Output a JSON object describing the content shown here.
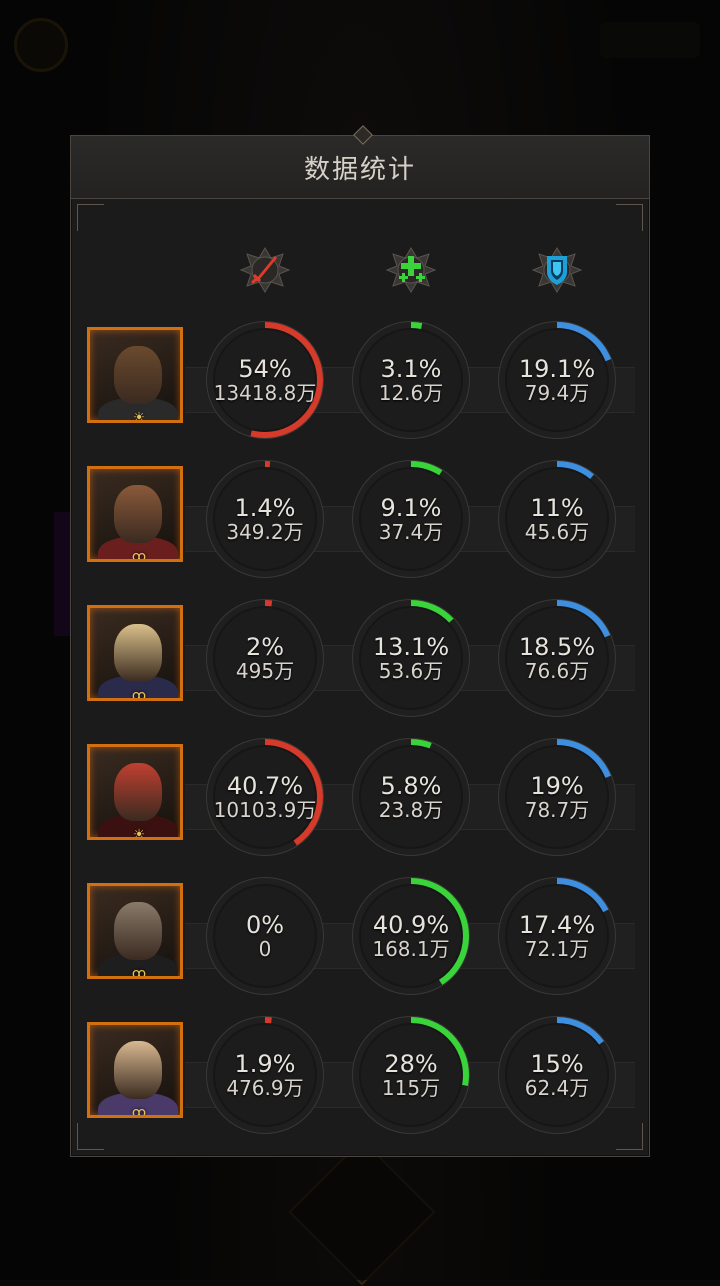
{
  "panel": {
    "title": "数据统计"
  },
  "columns": [
    {
      "icon": "sword-icon",
      "color": "#d63a2a"
    },
    {
      "icon": "heal-plus-icon",
      "color": "#39d33a"
    },
    {
      "icon": "shield-icon",
      "color": "#3f8fe0"
    }
  ],
  "heroes": [
    {
      "badge": "☀",
      "damage": {
        "pct": "54%",
        "val": "13418.8万",
        "frac": 0.54
      },
      "heal": {
        "pct": "3.1%",
        "val": "12.6万",
        "frac": 0.031
      },
      "tank": {
        "pct": "19.1%",
        "val": "79.4万",
        "frac": 0.191
      }
    },
    {
      "badge": "ꝏ",
      "damage": {
        "pct": "1.4%",
        "val": "349.2万",
        "frac": 0.014
      },
      "heal": {
        "pct": "9.1%",
        "val": "37.4万",
        "frac": 0.091
      },
      "tank": {
        "pct": "11%",
        "val": "45.6万",
        "frac": 0.11
      }
    },
    {
      "badge": "ꝏ",
      "damage": {
        "pct": "2%",
        "val": "495万",
        "frac": 0.02
      },
      "heal": {
        "pct": "13.1%",
        "val": "53.6万",
        "frac": 0.131
      },
      "tank": {
        "pct": "18.5%",
        "val": "76.6万",
        "frac": 0.185
      }
    },
    {
      "badge": "☀",
      "damage": {
        "pct": "40.7%",
        "val": "10103.9万",
        "frac": 0.407
      },
      "heal": {
        "pct": "5.8%",
        "val": "23.8万",
        "frac": 0.058
      },
      "tank": {
        "pct": "19%",
        "val": "78.7万",
        "frac": 0.19
      }
    },
    {
      "badge": "ꝏ",
      "damage": {
        "pct": "0%",
        "val": "0",
        "frac": 0
      },
      "heal": {
        "pct": "40.9%",
        "val": "168.1万",
        "frac": 0.409
      },
      "tank": {
        "pct": "17.4%",
        "val": "72.1万",
        "frac": 0.174
      }
    },
    {
      "badge": "ꝏ",
      "damage": {
        "pct": "1.9%",
        "val": "476.9万",
        "frac": 0.019
      },
      "heal": {
        "pct": "28%",
        "val": "115万",
        "frac": 0.28
      },
      "tank": {
        "pct": "15%",
        "val": "62.4万",
        "frac": 0.15
      }
    }
  ]
}
